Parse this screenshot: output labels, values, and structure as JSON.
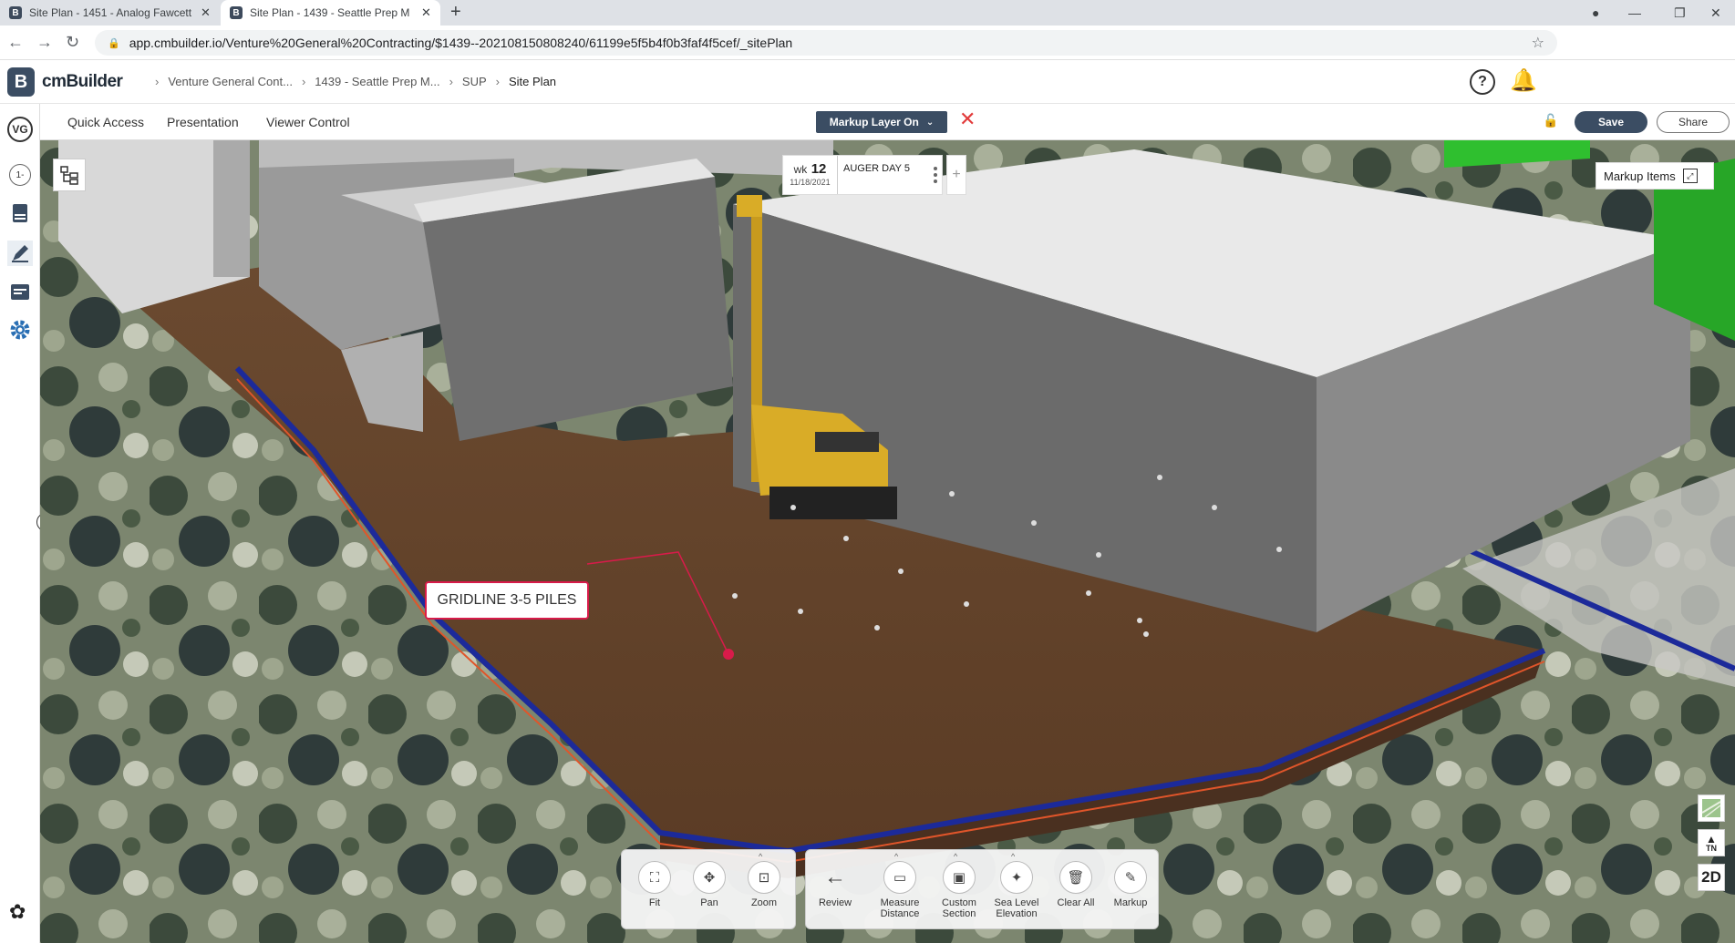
{
  "browser": {
    "tabs": [
      {
        "label": "Site Plan - 1451 - Analog Fawcett",
        "active": false
      },
      {
        "label": "Site Plan - 1439 - Seattle Prep M",
        "active": true
      }
    ],
    "url": "app.cmbuilder.io/Venture%20General%20Contracting/$1439--202108150808240/61199e5f5b4f0b3faf4f5cef/_sitePlan"
  },
  "header": {
    "brand": "cmBuilder",
    "logo_letter": "B",
    "breadcrumbs": [
      "Venture General Cont...",
      "1439 - Seattle Prep M...",
      "SUP",
      "Site Plan"
    ],
    "help_label": "?"
  },
  "rail": {
    "user_initials": "VG",
    "page_indicator": "1-"
  },
  "toolbar": {
    "menus": [
      "Quick Access",
      "Presentation",
      "Viewer Control"
    ],
    "markup_layer_label": "Markup Layer On",
    "save_label": "Save",
    "share_label": "Share"
  },
  "viewer": {
    "week": {
      "label": "wk",
      "number": "12",
      "date": "11/18/2021",
      "title": "AUGER DAY 5"
    },
    "markup_items_label": "Markup Items",
    "callout_text": "GRIDLINE 3-5 PILES",
    "side_buttons": {
      "north_label": "TN",
      "view_mode": "2D"
    },
    "nav_tools": [
      {
        "label": "Fit",
        "icon": "fit-icon"
      },
      {
        "label": "Pan",
        "icon": "pan-icon"
      },
      {
        "label": "Zoom",
        "icon": "zoom-icon"
      }
    ],
    "review_label": "Review",
    "analysis_tools": [
      {
        "label": "Measure Distance",
        "line1": "Measure",
        "line2": "Distance"
      },
      {
        "label": "Custom Section",
        "line1": "Custom",
        "line2": "Section"
      },
      {
        "label": "Sea Level Elevation",
        "line1": "Sea Level",
        "line2": "Elevation"
      },
      {
        "label": "Clear All",
        "line1": "Clear All",
        "line2": ""
      },
      {
        "label": "Markup",
        "line1": "Markup",
        "line2": ""
      }
    ]
  }
}
